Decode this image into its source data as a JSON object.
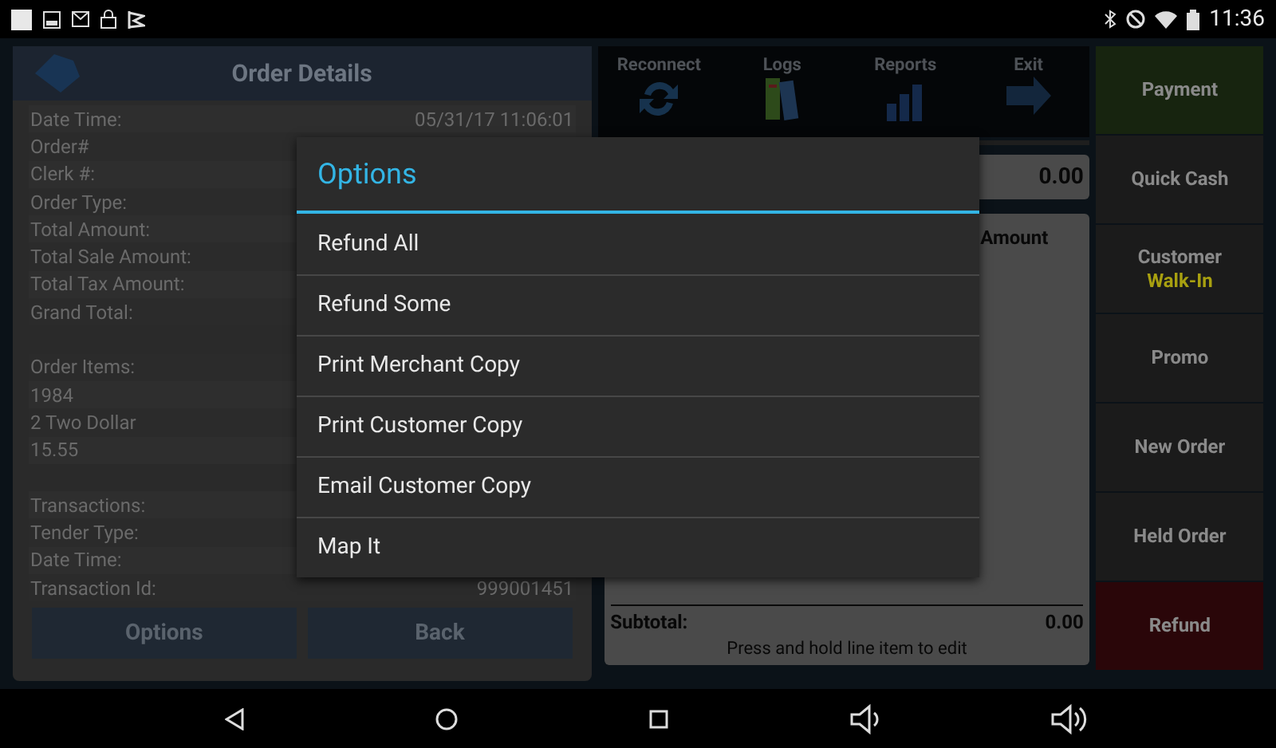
{
  "status_bar": {
    "time": "11:36"
  },
  "order_details": {
    "title": "Order Details",
    "rows": [
      {
        "kind": "field",
        "label": "Date Time:",
        "value": "05/31/17 11:06:01"
      },
      {
        "kind": "field",
        "label": "Order#"
      },
      {
        "kind": "field",
        "label": "Clerk #:"
      },
      {
        "kind": "field",
        "label": "Order Type:"
      },
      {
        "kind": "field",
        "label": "Total Amount:"
      },
      {
        "kind": "field",
        "label": "Total Sale Amount:"
      },
      {
        "kind": "field",
        "label": "Total Tax Amount:"
      },
      {
        "kind": "field",
        "label": "Grand Total:"
      },
      {
        "kind": "blank"
      },
      {
        "kind": "field",
        "label": "Order Items:"
      },
      {
        "kind": "field",
        "label": "1984"
      },
      {
        "kind": "field",
        "label": "2 Two Dollar"
      },
      {
        "kind": "field",
        "label": "15.55"
      },
      {
        "kind": "blank"
      },
      {
        "kind": "field",
        "label": "Transactions:"
      },
      {
        "kind": "field",
        "label": "Tender Type:"
      },
      {
        "kind": "field",
        "label": "Date Time:"
      },
      {
        "kind": "field",
        "label": "Transaction Id:",
        "value": "999001451"
      }
    ],
    "buttons": [
      "Options",
      "Back"
    ]
  },
  "toolbar": [
    {
      "label": "Reconnect",
      "kind": "reconnect"
    },
    {
      "label": "Logs",
      "kind": "logs"
    },
    {
      "label": "Reports",
      "kind": "reports"
    },
    {
      "label": "Exit",
      "kind": "exit"
    }
  ],
  "total_field": {
    "value": "0.00"
  },
  "cart": {
    "column": "Amount",
    "subtotal_label": "Subtotal:",
    "subtotal_value": "0.00",
    "hint": "Press and hold line item to edit"
  },
  "side_buttons": [
    {
      "label": "Payment",
      "color": "#17240f"
    },
    {
      "label": "Quick Cash",
      "color": "#1b1b1b"
    },
    {
      "label": "Customer",
      "sublabel": "Walk-In",
      "color": "#1b1b1b"
    },
    {
      "label": "Promo",
      "color": "#1b1b1b"
    },
    {
      "label": "New Order",
      "color": "#1b1b1b"
    },
    {
      "label": "Held Order",
      "color": "#1b1b1b"
    },
    {
      "label": "Refund",
      "color": "#2a0609"
    }
  ],
  "dialog": {
    "title": "Options",
    "items": [
      "Refund All",
      "Refund Some",
      "Print Merchant Copy",
      "Print Customer Copy",
      "Email Customer Copy",
      "Map It"
    ]
  }
}
